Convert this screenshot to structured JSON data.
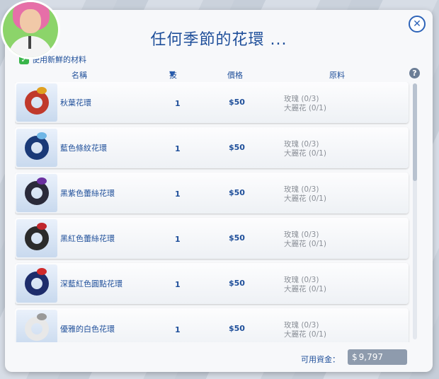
{
  "dialog": {
    "title": "任何季節的花環 ...",
    "close_label": "✕",
    "use_fresh_label": "使用新鮮的材料",
    "use_fresh_checked": true
  },
  "columns": {
    "name": "名稱",
    "skill": "技能",
    "price": "價格",
    "ingredients": "原料",
    "help": "?"
  },
  "items": [
    {
      "name": "秋葉花環",
      "skill": "1",
      "price": "50",
      "ing1": "玫瑰 (0/3)",
      "ing2": "大麗花 (0/1)",
      "wreath_color": "#c0392b",
      "bow_color": "#e0a020"
    },
    {
      "name": "藍色條紋花環",
      "skill": "1",
      "price": "50",
      "ing1": "玫瑰 (0/3)",
      "ing2": "大麗花 (0/1)",
      "wreath_color": "#1a3a78",
      "bow_color": "#6fb6e6"
    },
    {
      "name": "黑紫色蕾絲花環",
      "skill": "1",
      "price": "50",
      "ing1": "玫瑰 (0/3)",
      "ing2": "大麗花 (0/1)",
      "wreath_color": "#2a2a3a",
      "bow_color": "#6a2fa0"
    },
    {
      "name": "黑紅色蕾絲花環",
      "skill": "1",
      "price": "50",
      "ing1": "玫瑰 (0/3)",
      "ing2": "大麗花 (0/1)",
      "wreath_color": "#2b2b2b",
      "bow_color": "#c0262d"
    },
    {
      "name": "深藍紅色圓點花環",
      "skill": "1",
      "price": "50",
      "ing1": "玫瑰 (0/3)",
      "ing2": "大麗花 (0/1)",
      "wreath_color": "#1e2d6b",
      "bow_color": "#d02a2a"
    },
    {
      "name": "優雅的白色花環",
      "skill": "1",
      "price": "50",
      "ing1": "玫瑰 (0/3)",
      "ing2": "大麗花 (0/1)",
      "wreath_color": "#e8e8e8",
      "bow_color": "#999999"
    }
  ],
  "currency_symbol": "$",
  "funds": {
    "label": "可用資金：",
    "amount": "9,797"
  }
}
